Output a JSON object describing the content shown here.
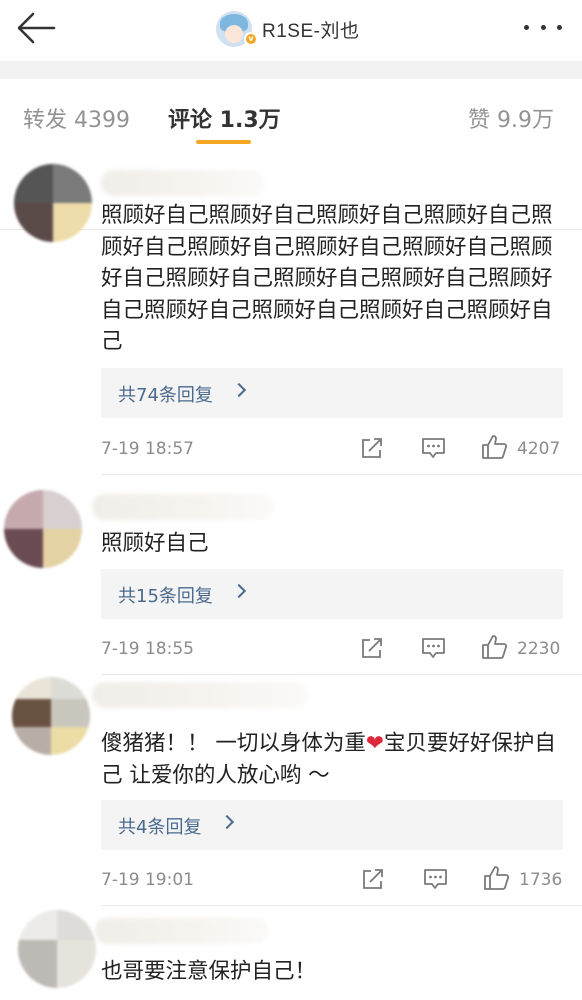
{
  "header": {
    "title": "R1SE-刘也",
    "verified_badge": "v"
  },
  "tabs": [
    {
      "label": "转发 4399"
    },
    {
      "label": "评论 1.3万"
    },
    {
      "label": "赞 9.9万"
    }
  ],
  "accent_color": "#f5a623",
  "comments": [
    {
      "text": "照顾好自己照顾好自己照顾好自己照顾好自己照顾好自己照顾好自己照顾好自己照顾好自己照顾好自己照顾好自己照顾好自己照顾好自己照顾好自己照顾好自己照顾好自己照顾好自己照顾好自己",
      "reply_label": "共74条回复",
      "time": "7-19 18:57",
      "likes": "4207"
    },
    {
      "text": "照顾好自己",
      "reply_label": "共15条回复",
      "time": "7-19 18:55",
      "likes": "2230"
    },
    {
      "text_before": "傻猪猪！！ 一切以身体为重",
      "text_after": "宝贝要好好保护自己 让爱你的人放心哟 ～",
      "reply_label": "共4条回复",
      "time": "7-19 19:01",
      "likes": "1736"
    },
    {
      "text": "也哥要注意保护自己！"
    }
  ]
}
